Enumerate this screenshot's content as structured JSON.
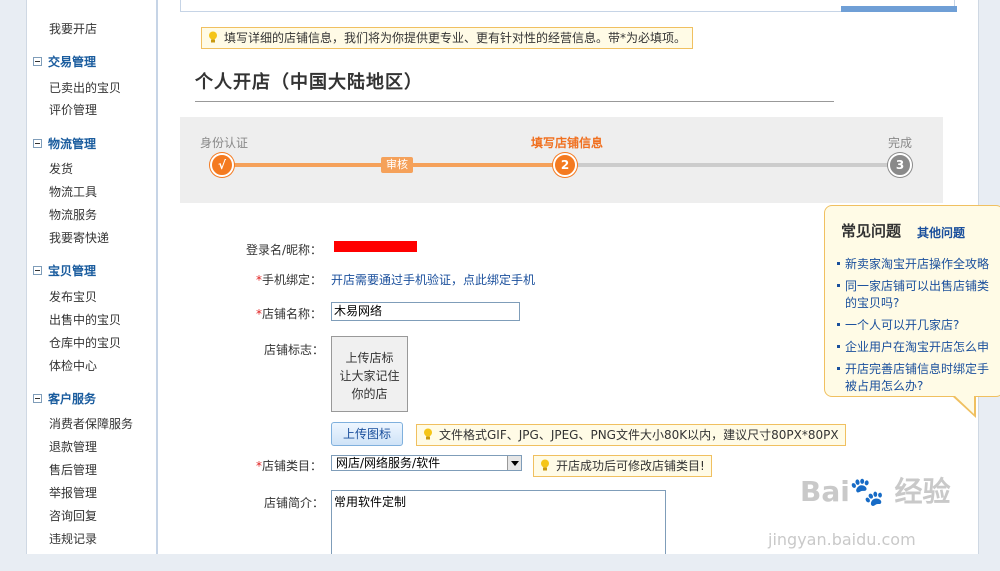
{
  "sidebar": {
    "top_item": "我要开店",
    "groups": [
      {
        "title": "交易管理",
        "items": [
          "已卖出的宝贝",
          "评价管理"
        ]
      },
      {
        "title": "物流管理",
        "items": [
          "发货",
          "物流工具",
          "物流服务",
          "我要寄快递"
        ]
      },
      {
        "title": "宝贝管理",
        "items": [
          "发布宝贝",
          "出售中的宝贝",
          "仓库中的宝贝",
          "体检中心"
        ]
      },
      {
        "title": "客户服务",
        "items": [
          "消费者保障服务",
          "退款管理",
          "售后管理",
          "举报管理",
          "咨询回复",
          "违规记录"
        ]
      }
    ]
  },
  "notice": "填写详细的店铺信息，我们将为你提供更专业、更有针对性的经营信息。带*为必填项。",
  "page_title": "个人开店（中国大陆地区）",
  "steps": {
    "labels": [
      "身份认证",
      "填写店铺信息",
      "完成"
    ],
    "circle_1": "√",
    "circle_2": "2",
    "circle_3": "3",
    "middle_tag": "审核"
  },
  "form": {
    "login_label": "登录名/昵称：",
    "phone_label": "手机绑定：",
    "phone_link": "开店需要通过手机验证，点此绑定手机",
    "shop_name_label": "店铺名称：",
    "shop_name_value": "木易网络",
    "logo_label": "店铺标志：",
    "logo_box_line1": "上传店标",
    "logo_box_line2": "让大家记住",
    "logo_box_line3": "你的店",
    "upload_button": "上传图标",
    "upload_tip": "文件格式GIF、JPG、JPEG、PNG文件大小80K以内，建议尺寸80PX*80PX",
    "category_label": "店铺类目：",
    "category_value": "网店/网络服务/软件",
    "category_tip": "开店成功后可修改店铺类目!",
    "intro_label": "店铺简介：",
    "intro_value": "常用软件定制",
    "required_mark": "*"
  },
  "faq": {
    "title": "常见问题",
    "more": "其他问题",
    "items": [
      "新卖家淘宝开店操作全攻略",
      "同一家店铺可以出售店铺类",
      "的宝贝吗?",
      "一个人可以开几家店?",
      "企业用户在淘宝开店怎么申",
      "开店完善店铺信息时绑定手",
      "被占用怎么办?"
    ]
  },
  "watermark": {
    "text": "Bai🐾 经验",
    "url": "jingyan.baidu.com"
  },
  "colors": {
    "accent_orange": "#f47a20",
    "link_blue": "#1a4f9c",
    "tip_border": "#f0c060"
  }
}
